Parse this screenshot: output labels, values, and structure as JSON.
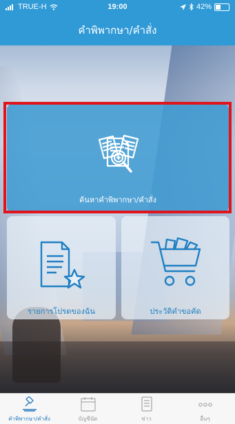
{
  "status_bar": {
    "carrier": "TRUE-H",
    "time": "19:00",
    "battery": "42%",
    "battery_level": 0.42
  },
  "nav": {
    "title": "คำพิพากษา/คำสั่ง"
  },
  "tiles": {
    "search": {
      "label": "ค้นหาคำพิพากษา/คำสั่ง",
      "icon": "document-search-icon"
    },
    "favorites": {
      "label": "รายการโปรดของฉัน",
      "icon": "document-star-icon"
    },
    "history": {
      "label": "ประวัติคำขอคัด",
      "icon": "shopping-cart-icon"
    }
  },
  "tab_bar": {
    "items": [
      {
        "label": "คำพิพากษา/คำสั่ง",
        "icon": "gavel-icon",
        "active": true
      },
      {
        "label": "บัญชีนัด",
        "icon": "calendar-icon",
        "active": false
      },
      {
        "label": "ข่าว",
        "icon": "news-icon",
        "active": false
      },
      {
        "label": "อื่นๆ",
        "icon": "more-icon",
        "active": false
      }
    ]
  },
  "colors": {
    "primary": "#2f9ad6",
    "highlight": "#e0141c",
    "tab_active": "#2f7fbf"
  }
}
